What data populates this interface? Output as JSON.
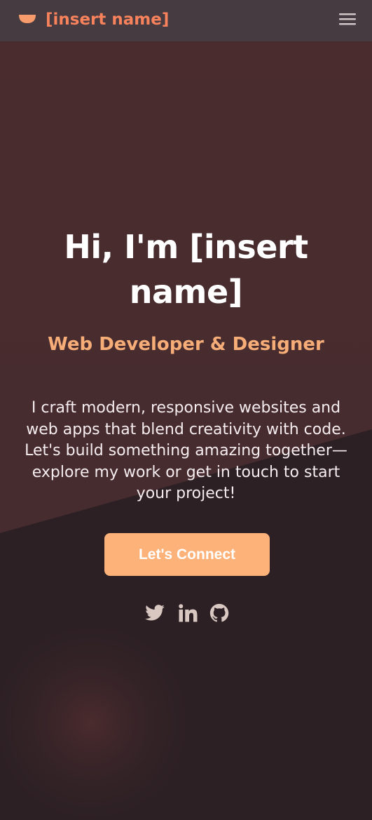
{
  "header": {
    "brand": "[insert name]",
    "logo_icon": "bowl-icon",
    "menu_icon": "hamburger-menu-icon"
  },
  "hero": {
    "title": "Hi, I'm [insert name]",
    "subtitle": "Web Developer & Designer",
    "description": "I craft modern, responsive websites and web apps that blend creativity with code. Let's build something amazing together—explore my work or get in touch to start your project!",
    "cta_label": "Let's Connect"
  },
  "social": [
    {
      "icon": "twitter-icon"
    },
    {
      "icon": "linkedin-icon"
    },
    {
      "icon": "github-icon"
    }
  ],
  "colors": {
    "header_bg": "#463b40",
    "hero_upper_bg": "#4a2d2f",
    "page_bg": "#2c2024",
    "brand": "#f8825c",
    "accent": "#f7ad78",
    "button_bg": "#fdb27a",
    "social_icon": "#d9c8c2"
  }
}
